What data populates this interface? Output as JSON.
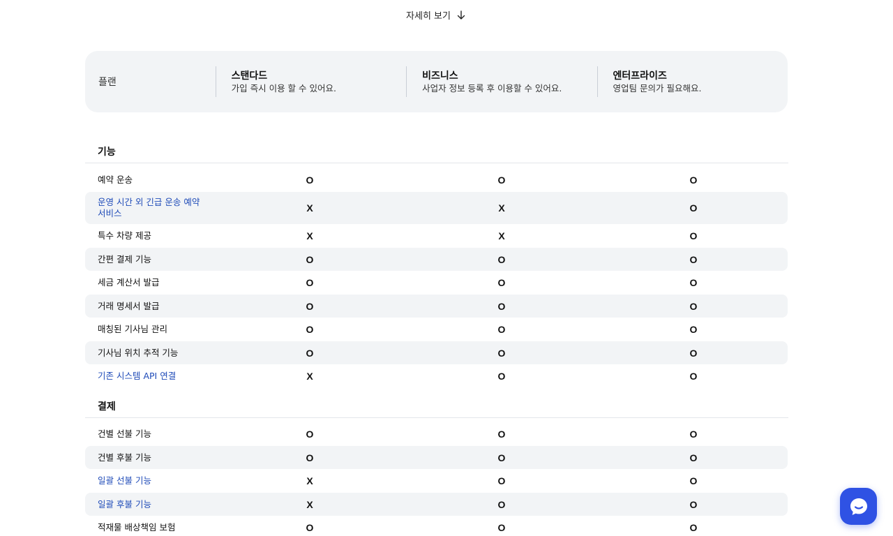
{
  "see_more": {
    "label": "자세히 보기",
    "icon": "arrow-down-icon"
  },
  "plans": {
    "label": "플랜",
    "columns": [
      {
        "name": "스탠다드",
        "desc": "가입 즉시 이용 할 수 있어요."
      },
      {
        "name": "비즈니스",
        "desc": "사업자 정보 등록 후 이용할 수 있어요."
      },
      {
        "name": "엔터프라이즈",
        "desc": "영업팀 문의가 필요해요."
      }
    ]
  },
  "sections": [
    {
      "title": "기능",
      "rows": [
        {
          "label": "예약 운송",
          "values": [
            "O",
            "O",
            "O"
          ],
          "link": false
        },
        {
          "label": "운영 시간 외 긴급 운송 예약 서비스",
          "values": [
            "X",
            "X",
            "O"
          ],
          "link": true
        },
        {
          "label": "특수 차량 제공",
          "values": [
            "X",
            "X",
            "O"
          ],
          "link": false
        },
        {
          "label": "간편 결제 기능",
          "values": [
            "O",
            "O",
            "O"
          ],
          "link": false
        },
        {
          "label": "세금 계산서 발급",
          "values": [
            "O",
            "O",
            "O"
          ],
          "link": false
        },
        {
          "label": "거래 명세서 발급",
          "values": [
            "O",
            "O",
            "O"
          ],
          "link": false
        },
        {
          "label": "매칭된 기사님 관리",
          "values": [
            "O",
            "O",
            "O"
          ],
          "link": false
        },
        {
          "label": "기사님 위치 추적 기능",
          "values": [
            "O",
            "O",
            "O"
          ],
          "link": false
        },
        {
          "label": "기존 시스템 API 연결",
          "values": [
            "X",
            "O",
            "O"
          ],
          "link": true
        }
      ]
    },
    {
      "title": "결제",
      "rows": [
        {
          "label": "건별 선불 기능",
          "values": [
            "O",
            "O",
            "O"
          ],
          "link": false
        },
        {
          "label": "건별 후불 기능",
          "values": [
            "O",
            "O",
            "O"
          ],
          "link": false
        },
        {
          "label": "일괄 선불 기능",
          "values": [
            "X",
            "O",
            "O"
          ],
          "link": true
        },
        {
          "label": "일괄 후불 기능",
          "values": [
            "X",
            "O",
            "O"
          ],
          "link": true
        },
        {
          "label": "적재물 배상책임 보험",
          "values": [
            "O",
            "O",
            "O"
          ],
          "link": false
        }
      ]
    }
  ],
  "chat_button": {
    "icon": "chat-bubble-icon",
    "color": "#2f52e4"
  }
}
